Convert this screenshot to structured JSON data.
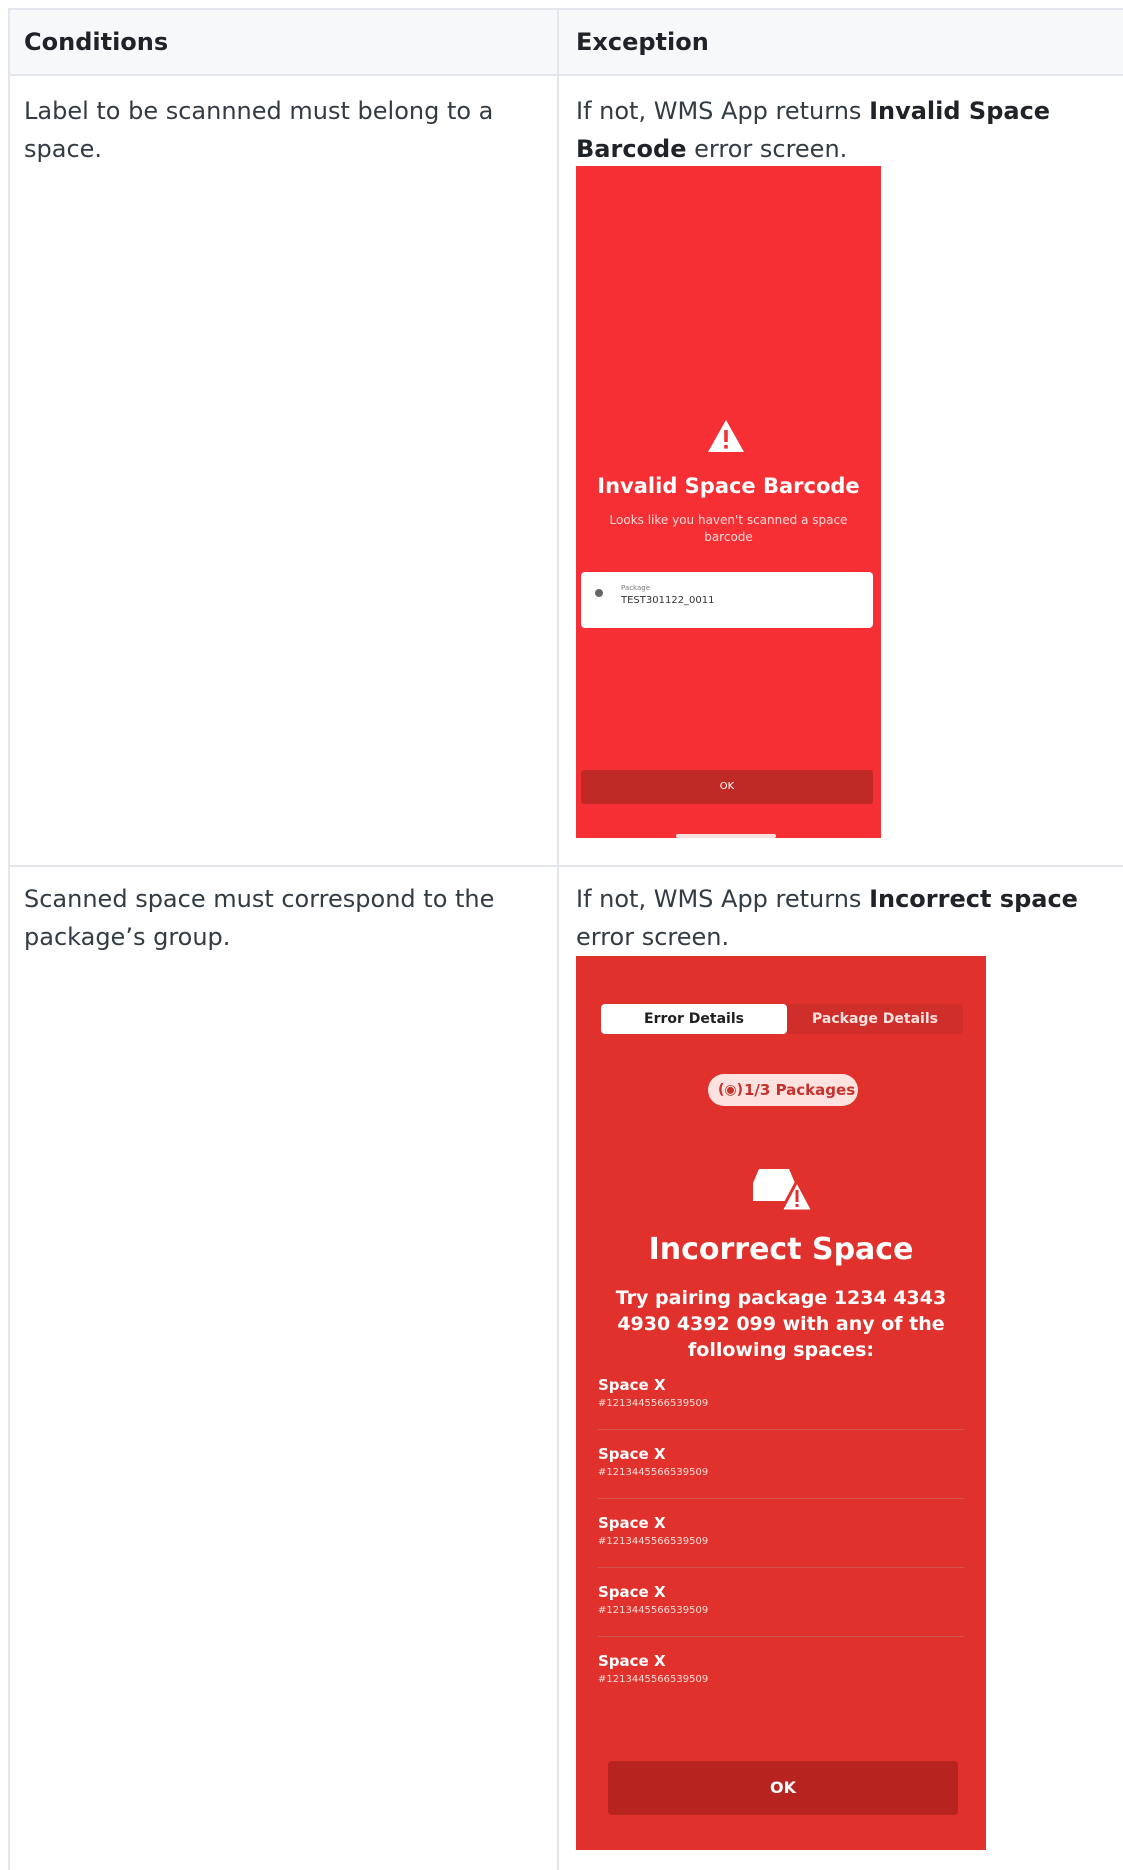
{
  "table": {
    "headers": [
      "Conditions",
      "Exception"
    ],
    "rows": [
      {
        "condition": "Label to be scannned must belong to a space.",
        "exception_prefix": "If not, WMS App returns",
        "exception_bold": "Invalid Space Barcode",
        "exception_suffix": "error screen."
      },
      {
        "condition": "Scanned space must correspond to the package’s group.",
        "exception_prefix": "If not, WMS App returns",
        "exception_bold": "Incorrect space",
        "exception_suffix": "error screen."
      }
    ]
  },
  "screen1": {
    "background": "#f52f33",
    "icon": "warning-icon",
    "title": "Invalid Space Barcode",
    "subtitle": "Looks like you haven't scanned a space barcode",
    "card_label": "Package",
    "card_value": "TEST301122_0011",
    "ok_label": "OK"
  },
  "screen2": {
    "background": "#e1312c",
    "tabs": [
      "Error Details",
      "Package Details"
    ],
    "pill_icon": "target-icon",
    "pill_label": "1/3 Packages",
    "icon": "box-warning-icon",
    "title": "Incorrect Space",
    "subtitle": "Try pairing package 1234 4343 4930 4392 099 with any of the following spaces:",
    "spaces": [
      {
        "name": "Space X",
        "code": "#1213445566539509"
      },
      {
        "name": "Space X",
        "code": "#1213445566539509"
      },
      {
        "name": "Space X",
        "code": "#1213445566539509"
      },
      {
        "name": "Space X",
        "code": "#1213445566539509"
      },
      {
        "name": "Space X",
        "code": "#1213445566539509"
      }
    ],
    "ok_label": "OK"
  }
}
